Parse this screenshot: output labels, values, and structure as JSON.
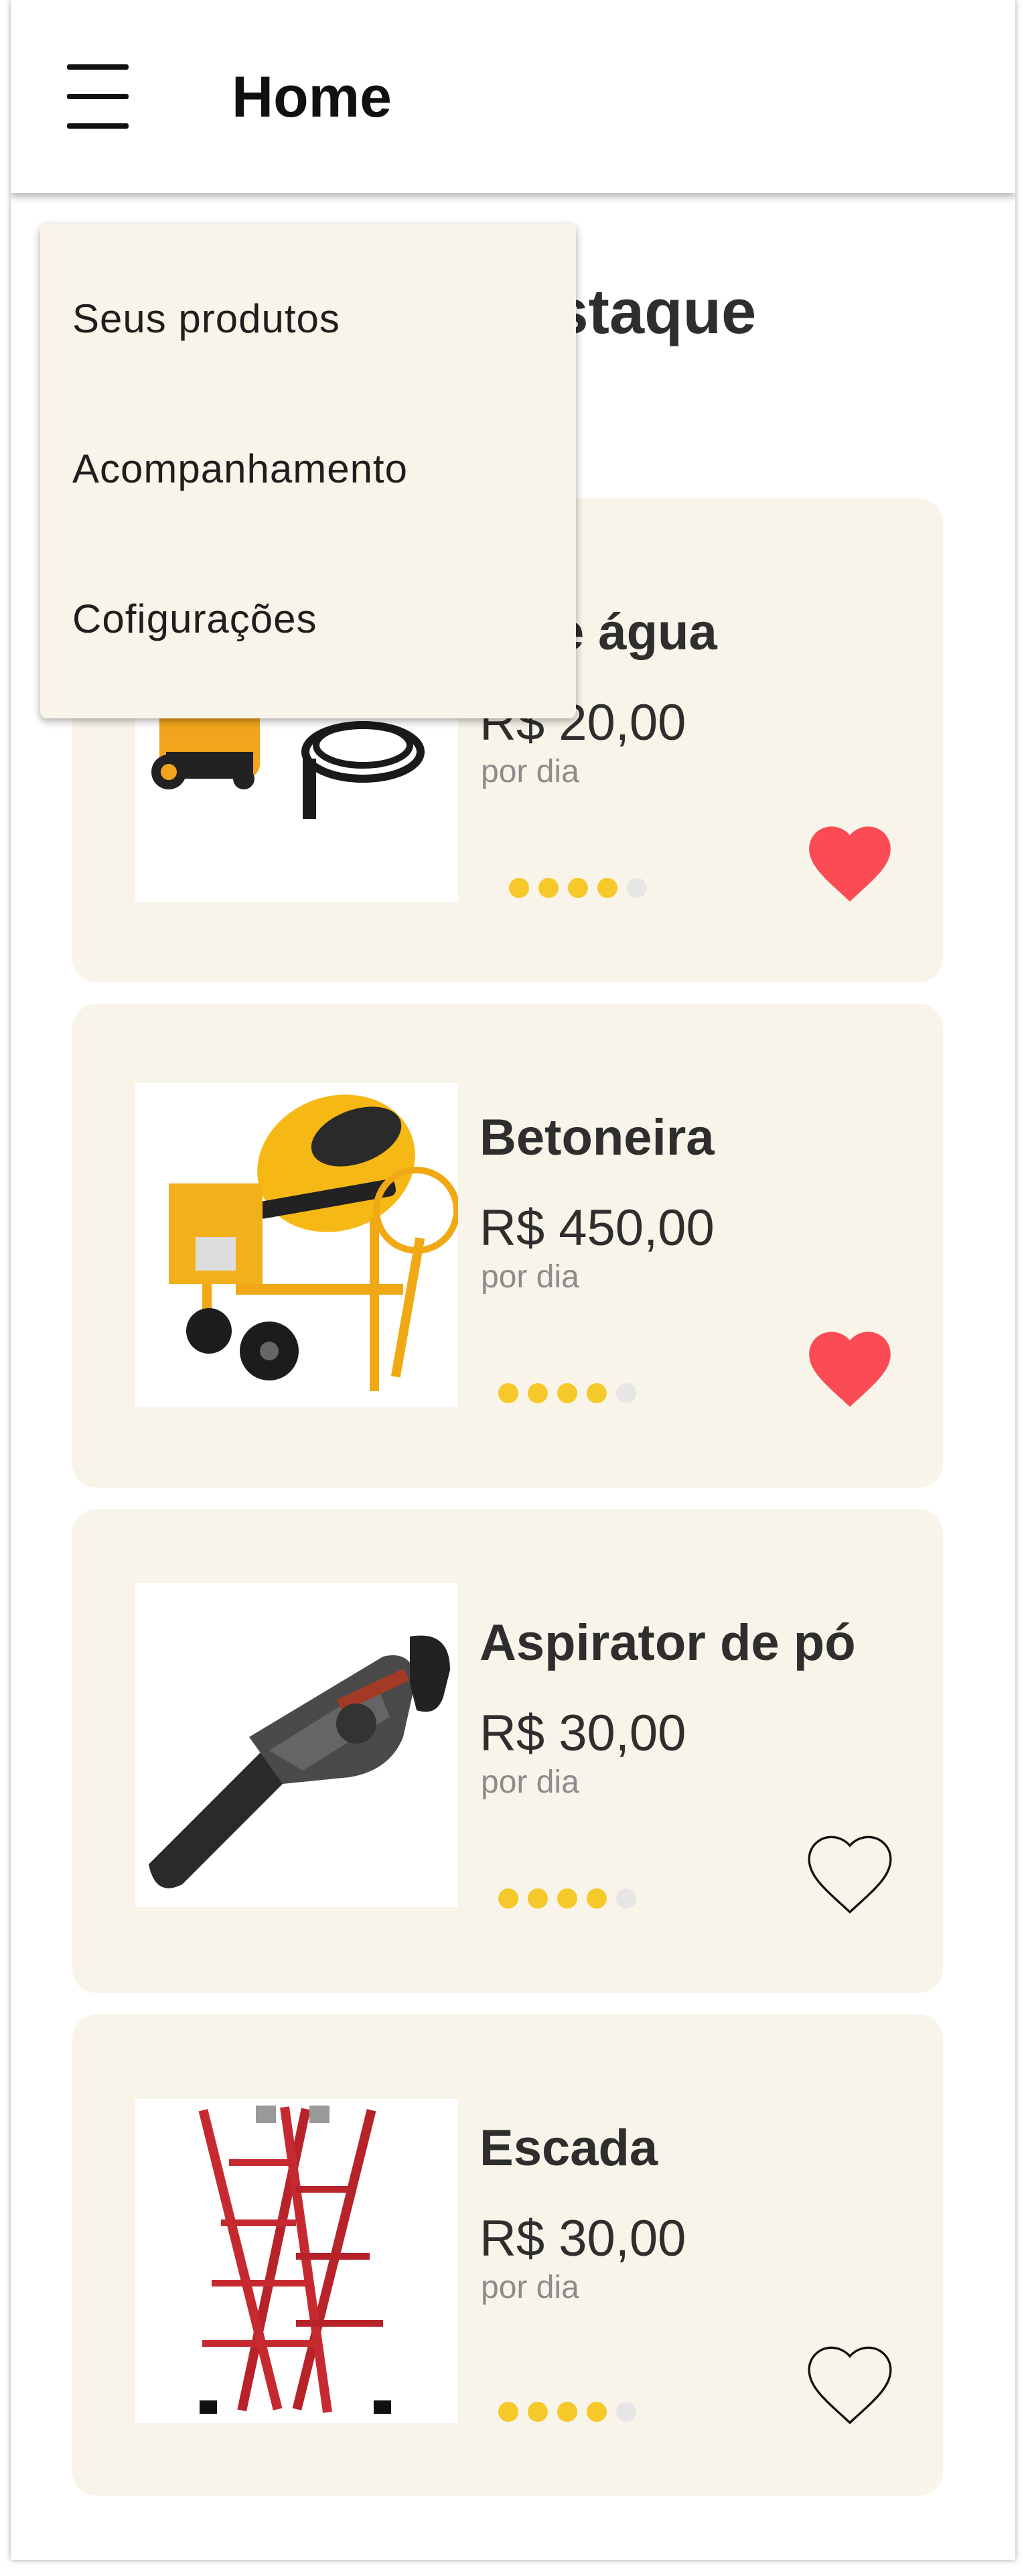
{
  "app_bar": {
    "title": "Home",
    "menu_icon": "hamburger-menu-icon"
  },
  "section": {
    "title": "Produtos em destaque"
  },
  "dropdown_menu": {
    "items": [
      {
        "label": "Seus produtos"
      },
      {
        "label": "Acompanhamento"
      },
      {
        "label": "Cofigurações"
      }
    ]
  },
  "products": [
    {
      "name": "Lavadora de alta pressão de água",
      "visible_name": "o de água",
      "price": "R$ 20,00",
      "unit": "por dia",
      "rating": 4,
      "rating_max": 5,
      "favorite": true,
      "image": "pressure-washer-image"
    },
    {
      "name": "Betoneira",
      "visible_name": "Betoneira",
      "price": "R$ 450,00",
      "unit": "por dia",
      "rating": 4,
      "rating_max": 5,
      "favorite": true,
      "image": "concrete-mixer-image"
    },
    {
      "name": "Aspirator de pó",
      "visible_name": "Aspirator de pó",
      "price": "R$ 30,00",
      "unit": "por dia",
      "rating": 4,
      "rating_max": 5,
      "favorite": false,
      "image": "vacuum-cleaner-image"
    },
    {
      "name": "Escada",
      "visible_name": "Escada",
      "price": "R$ 30,00",
      "unit": "por dia",
      "rating": 4,
      "rating_max": 5,
      "favorite": false,
      "image": "ladder-image"
    }
  ],
  "colors": {
    "card_background": "#f8f4e9",
    "text_dark": "#2e2e2e",
    "text_muted": "#8c8c8c",
    "rating_filled": "#f5c92a",
    "rating_empty": "#e6e6e6",
    "favorite_active": "#fb4b55",
    "favorite_inactive": "#111111",
    "menu_background": "#f8f4e9"
  }
}
